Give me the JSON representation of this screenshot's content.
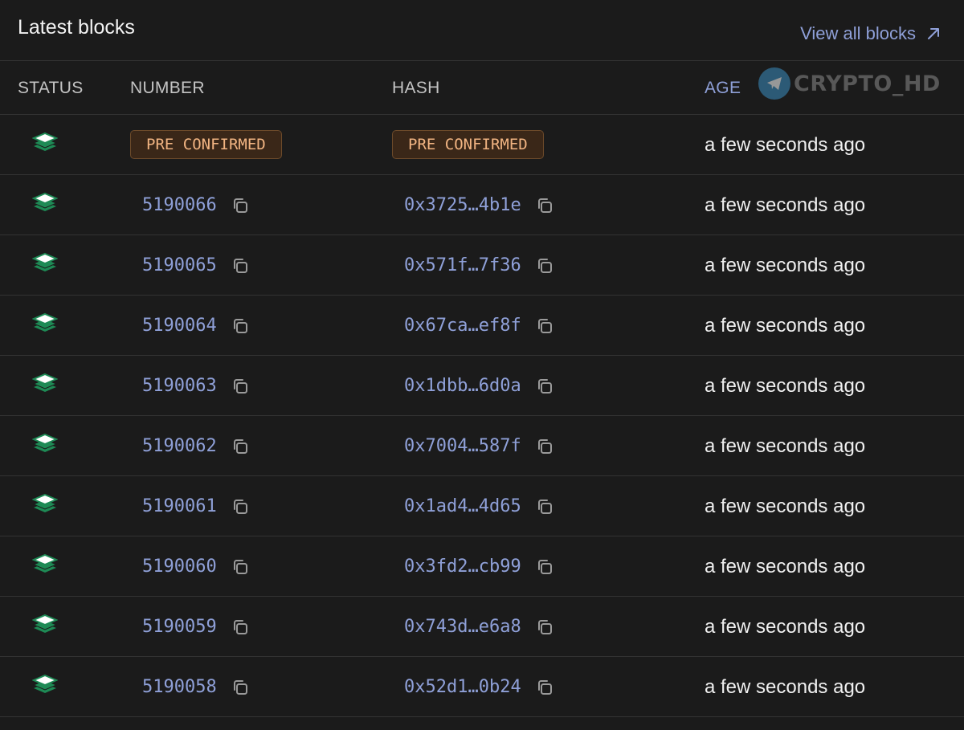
{
  "header": {
    "title": "Latest blocks",
    "view_all_label": "View all blocks"
  },
  "columns": {
    "status": "STATUS",
    "number": "NUMBER",
    "hash": "HASH",
    "age": "AGE"
  },
  "watermark": {
    "text": "CRYPTO_HD"
  },
  "pending_row": {
    "number_badge": "PRE CONFIRMED",
    "hash_badge": "PRE CONFIRMED",
    "age": "a few seconds ago"
  },
  "blocks": [
    {
      "number": "5190066",
      "hash": "0x3725…4b1e",
      "age": "a few seconds ago"
    },
    {
      "number": "5190065",
      "hash": "0x571f…7f36",
      "age": "a few seconds ago"
    },
    {
      "number": "5190064",
      "hash": "0x67ca…ef8f",
      "age": "a few seconds ago"
    },
    {
      "number": "5190063",
      "hash": "0x1dbb…6d0a",
      "age": "a few seconds ago"
    },
    {
      "number": "5190062",
      "hash": "0x7004…587f",
      "age": "a few seconds ago"
    },
    {
      "number": "5190061",
      "hash": "0x1ad4…4d65",
      "age": "a few seconds ago"
    },
    {
      "number": "5190060",
      "hash": "0x3fd2…cb99",
      "age": "a few seconds ago"
    },
    {
      "number": "5190059",
      "hash": "0x743d…e6a8",
      "age": "a few seconds ago"
    },
    {
      "number": "5190058",
      "hash": "0x52d1…0b24",
      "age": "a few seconds ago"
    }
  ],
  "colors": {
    "background": "#1b1b1b",
    "link": "#8fa0d8",
    "badge_text": "#f1b482",
    "badge_bg": "#3a2718",
    "status_green": "#1e8a55"
  },
  "icons": {
    "status": "layers-icon",
    "copy": "copy-icon",
    "external": "arrow-up-right-icon",
    "telegram": "telegram-icon"
  }
}
